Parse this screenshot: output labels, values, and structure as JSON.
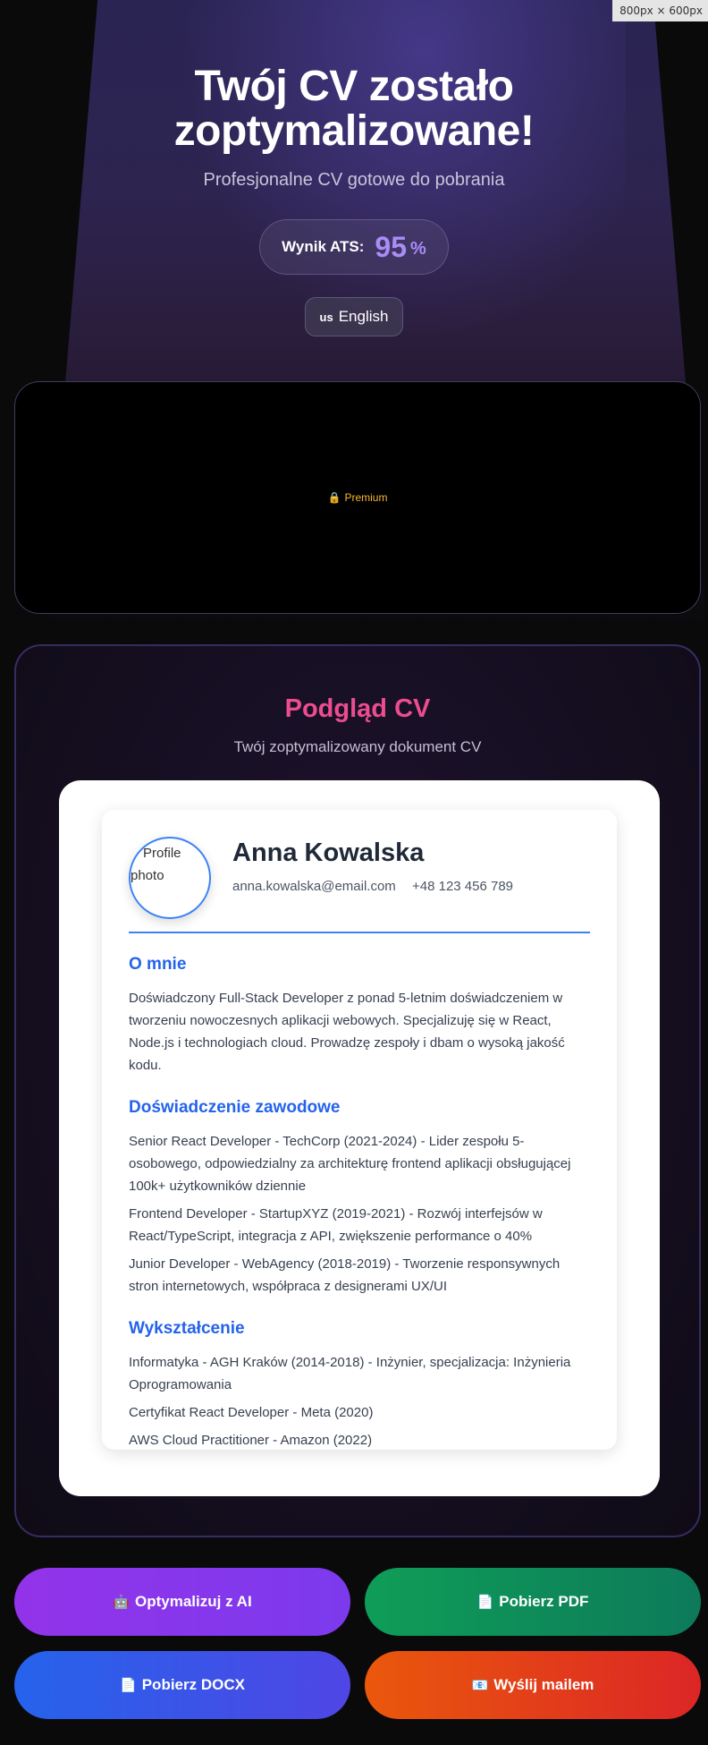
{
  "viewport_badge": "800px × 600px",
  "hero": {
    "title_line1": "Twój CV zostało",
    "title_line2": "zoptymalizowane!",
    "subtitle": "Profesjonalne CV gotowe do pobrania",
    "ats_label": "Wynik ATS:",
    "ats_score": "95",
    "ats_unit": "%",
    "language_flag": "us",
    "language_label": "English"
  },
  "ad": {
    "premium_label": "Premium",
    "icon": "lock-icon"
  },
  "preview": {
    "title": "Podgląd CV",
    "subtitle": "Twój zoptymalizowany dokument CV",
    "cv": {
      "photo_alt_line1": "Profile",
      "photo_alt_line2": "photo",
      "name": "Anna Kowalska",
      "email": "anna.kowalska@email.com",
      "phone": "+48 123 456 789",
      "about_title": "O mnie",
      "about_text": "Doświadczony Full-Stack Developer z ponad 5-letnim doświadczeniem w tworzeniu nowoczesnych aplikacji webowych. Specjalizuję się w React, Node.js i technologiach cloud. Prowadzę zespoły i dbam o wysoką jakość kodu.",
      "experience_title": "Doświadczenie zawodowe",
      "experience": [
        "Senior React Developer - TechCorp (2021-2024) - Lider zespołu 5-osobowego, odpowiedzialny za architekturę frontend aplikacji obsługującej 100k+ użytkowników dziennie",
        "Frontend Developer - StartupXYZ (2019-2021) - Rozwój interfejsów w React/TypeScript, integracja z API, zwiększenie performance o 40%",
        "Junior Developer - WebAgency (2018-2019) - Tworzenie responsywnych stron internetowych, współpraca z designerami UX/UI"
      ],
      "education_title": "Wykształcenie",
      "education": [
        "Informatyka - AGH Kraków (2014-2018) - Inżynier, specjalizacja: Inżynieria Oprogramowania",
        "Certyfikat React Developer - Meta (2020)",
        "AWS Cloud Practitioner - Amazon (2022)"
      ]
    }
  },
  "actions": {
    "optimize_ai": {
      "icon": "🤖",
      "label": "Optymalizuj z AI"
    },
    "download_pdf": {
      "icon": "📄",
      "label": "Pobierz PDF"
    },
    "download_docx": {
      "icon": "📄",
      "label": "Pobierz DOCX"
    },
    "send_email": {
      "icon": "📧",
      "label": "Wyślij mailem"
    }
  },
  "colors": {
    "accent_purple": "#a98cf6",
    "accent_pink": "#ec4d8e",
    "cv_blue": "#2563eb",
    "premium_gold": "#f7b733"
  }
}
